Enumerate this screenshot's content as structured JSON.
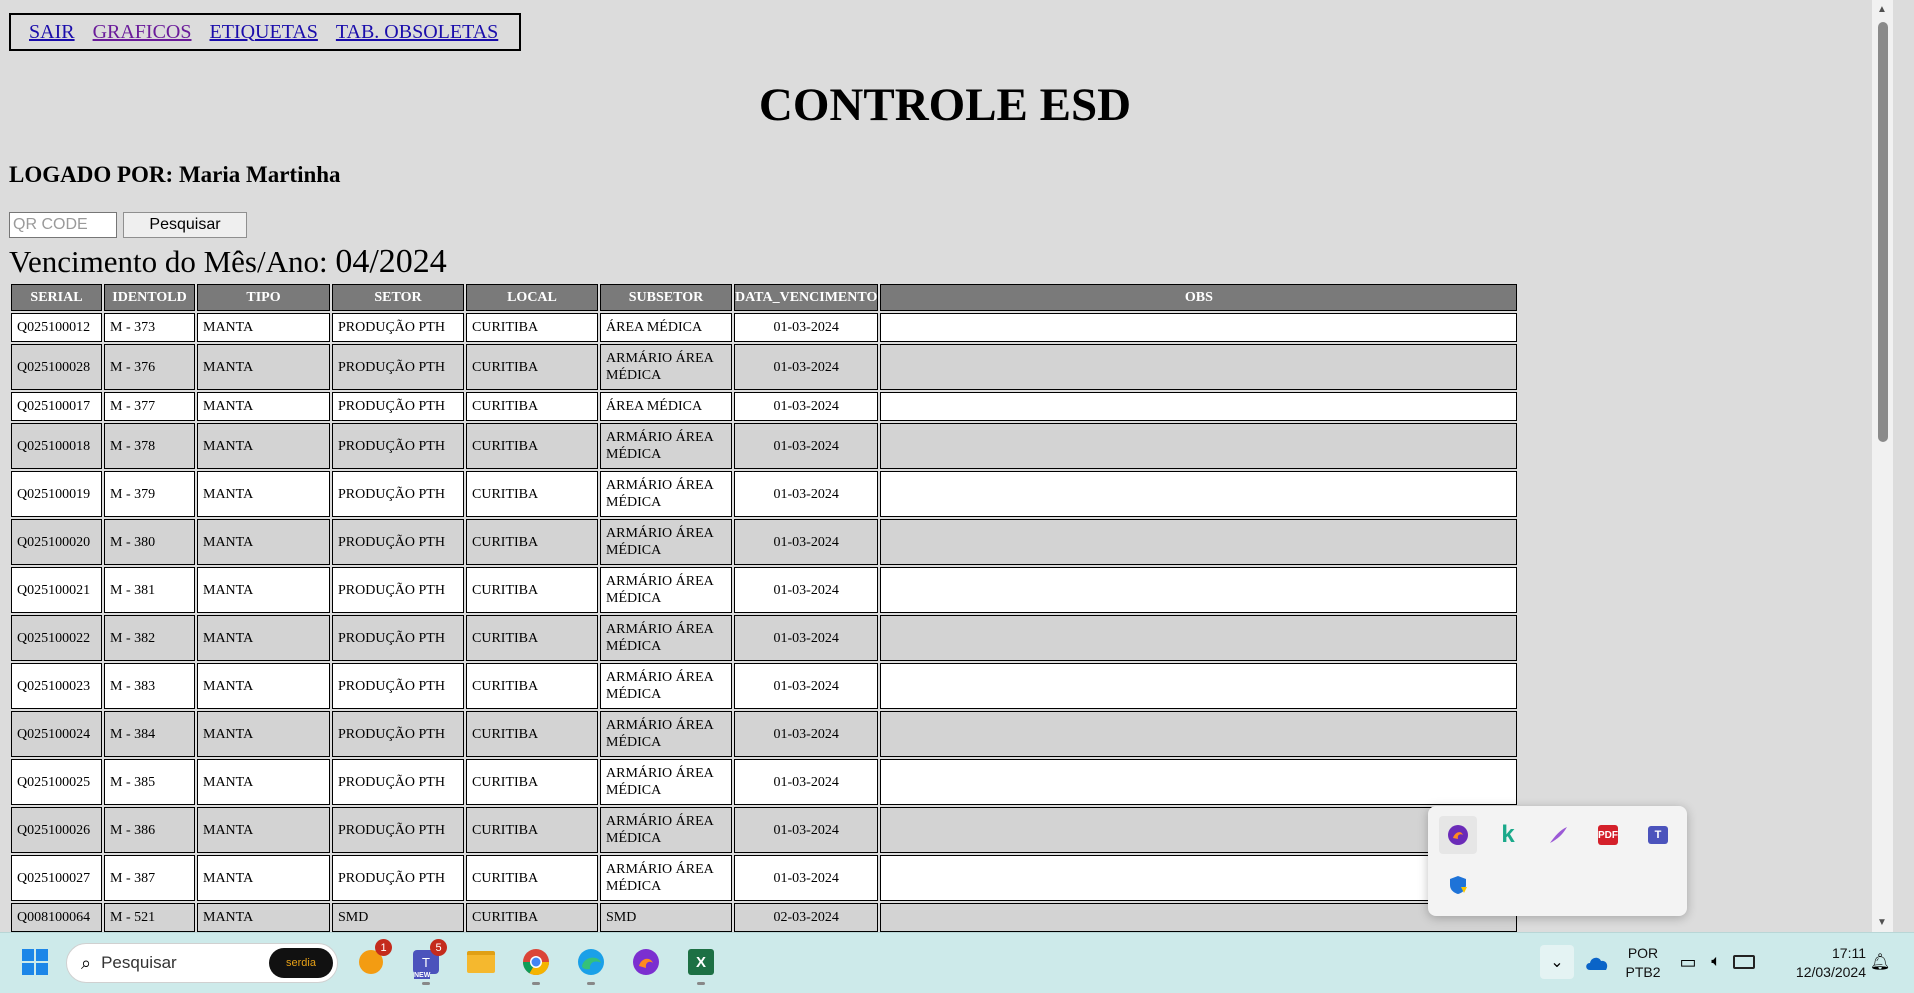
{
  "nav": {
    "links": [
      "SAIR",
      "GRAFICOS",
      "ETIQUETAS",
      "TAB. OBSOLETAS"
    ]
  },
  "title": "CONTROLE ESD",
  "logged": {
    "label": "LOGADO POR:",
    "user": "Maria Martinha"
  },
  "search": {
    "placeholder": "QR CODE",
    "value": "",
    "button": "Pesquisar"
  },
  "venc": {
    "label": "Vencimento do Mês/Ano:",
    "value": "04/2024"
  },
  "table": {
    "columns": [
      "SERIAL",
      "IDENTOLD",
      "TIPO",
      "SETOR",
      "LOCAL",
      "SUBSETOR",
      "DATA_VENCIMENTO",
      "OBS"
    ],
    "rows": [
      [
        "Q025100012",
        "M - 373",
        "MANTA",
        "PRODUÇÃO PTH",
        "CURITIBA",
        "ÁREA MÉDICA",
        "01-03-2024",
        ""
      ],
      [
        "Q025100028",
        "M - 376",
        "MANTA",
        "PRODUÇÃO PTH",
        "CURITIBA",
        "ARMÁRIO ÁREA MÉDICA",
        "01-03-2024",
        ""
      ],
      [
        "Q025100017",
        "M - 377",
        "MANTA",
        "PRODUÇÃO PTH",
        "CURITIBA",
        "ÁREA MÉDICA",
        "01-03-2024",
        ""
      ],
      [
        "Q025100018",
        "M - 378",
        "MANTA",
        "PRODUÇÃO PTH",
        "CURITIBA",
        "ARMÁRIO ÁREA MÉDICA",
        "01-03-2024",
        ""
      ],
      [
        "Q025100019",
        "M - 379",
        "MANTA",
        "PRODUÇÃO PTH",
        "CURITIBA",
        "ARMÁRIO ÁREA MÉDICA",
        "01-03-2024",
        ""
      ],
      [
        "Q025100020",
        "M - 380",
        "MANTA",
        "PRODUÇÃO PTH",
        "CURITIBA",
        "ARMÁRIO ÁREA MÉDICA",
        "01-03-2024",
        ""
      ],
      [
        "Q025100021",
        "M - 381",
        "MANTA",
        "PRODUÇÃO PTH",
        "CURITIBA",
        "ARMÁRIO ÁREA MÉDICA",
        "01-03-2024",
        ""
      ],
      [
        "Q025100022",
        "M - 382",
        "MANTA",
        "PRODUÇÃO PTH",
        "CURITIBA",
        "ARMÁRIO ÁREA MÉDICA",
        "01-03-2024",
        ""
      ],
      [
        "Q025100023",
        "M - 383",
        "MANTA",
        "PRODUÇÃO PTH",
        "CURITIBA",
        "ARMÁRIO ÁREA MÉDICA",
        "01-03-2024",
        ""
      ],
      [
        "Q025100024",
        "M - 384",
        "MANTA",
        "PRODUÇÃO PTH",
        "CURITIBA",
        "ARMÁRIO ÁREA MÉDICA",
        "01-03-2024",
        ""
      ],
      [
        "Q025100025",
        "M - 385",
        "MANTA",
        "PRODUÇÃO PTH",
        "CURITIBA",
        "ARMÁRIO ÁREA MÉDICA",
        "01-03-2024",
        ""
      ],
      [
        "Q025100026",
        "M - 386",
        "MANTA",
        "PRODUÇÃO PTH",
        "CURITIBA",
        "ARMÁRIO ÁREA MÉDICA",
        "01-03-2024",
        ""
      ],
      [
        "Q025100027",
        "M - 387",
        "MANTA",
        "PRODUÇÃO PTH",
        "CURITIBA",
        "ARMÁRIO ÁREA MÉDICA",
        "01-03-2024",
        ""
      ],
      [
        "Q008100064",
        "M - 521",
        "MANTA",
        "SMD",
        "CURITIBA",
        "SMD",
        "02-03-2024",
        ""
      ]
    ]
  },
  "tray_popup": {
    "icons": [
      "firefox-icon",
      "kaspersky-icon",
      "quill-icon",
      "pdf-icon",
      "teams-new-icon",
      "security-shield-warning-icon"
    ]
  },
  "taskbar": {
    "search_label": "Pesquisar",
    "search_brand": "serdia",
    "app_icons": [
      "windows-start-icon",
      "weather-icon",
      "teams-icon",
      "file-explorer-icon",
      "chrome-icon",
      "edge-icon",
      "firefox-icon",
      "excel-icon"
    ],
    "badges": {
      "weather": "1",
      "teams": "5"
    },
    "teams_tag": "NEW",
    "lang": {
      "line1": "POR",
      "line2": "PTB2"
    },
    "time": "17:11",
    "date": "12/03/2024",
    "colors": {
      "taskbar": "#cdeaea",
      "header": "#7a7a7a",
      "row_alt": "#d3d3d3"
    }
  }
}
